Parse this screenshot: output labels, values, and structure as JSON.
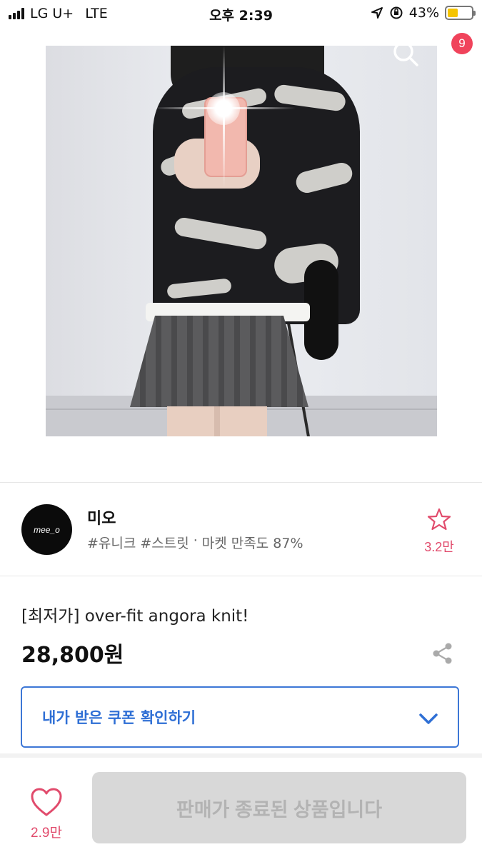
{
  "status_bar": {
    "carrier": "LG U+",
    "network": "LTE",
    "time": "오후 2:39",
    "battery": "43%",
    "battery_level": 0.43
  },
  "nav": {
    "back_icon": "chevron-left-icon",
    "search_icon": "search-icon",
    "cart_icon": "cart-icon",
    "cart_count": "9"
  },
  "shop": {
    "logo_text": "mee_o",
    "name": "미오",
    "tags": [
      "#유니크",
      "#스트릿"
    ],
    "separator": "·",
    "satisfaction": "마켓 만족도 87%",
    "favorite_count": "3.2만"
  },
  "product": {
    "title": "[최저가] over-fit angora knit!",
    "price": "28,800원"
  },
  "coupon": {
    "label": "내가 받은 쿠폰 확인하기"
  },
  "bottom_bar": {
    "like_count": "2.9만",
    "buy_label": "판매가 종료된 상품입니다"
  },
  "colors": {
    "accent_pink": "#e14b6c",
    "badge_red": "#f0435b",
    "coupon_blue": "#2f6fd5",
    "disabled_gray": "#d8d8d8"
  }
}
